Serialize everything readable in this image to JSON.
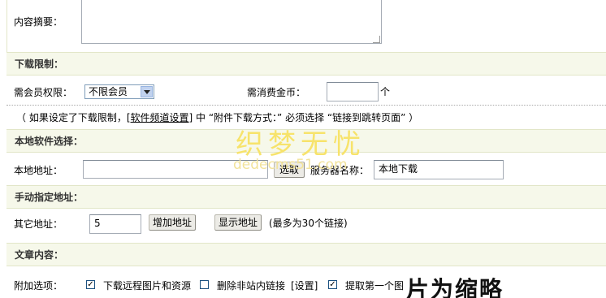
{
  "summary": {
    "label": "内容摘要：",
    "value": ""
  },
  "download_limit": {
    "section_title": "下载限制：",
    "member_label": "需会员权限：",
    "member_select": "不限会员",
    "coins_label": "需消费金币：",
    "coins_value": "",
    "coins_unit": "个",
    "note_prefix": "（ 如果设定了下载限制，[",
    "note_link": "软件频道设置",
    "note_suffix": "] 中 “附件下载方式：” 必须选择 “链接到跳转页面” ）"
  },
  "local_software": {
    "section_title": "本地软件选择：",
    "address_label": "本地地址：",
    "address_value": "",
    "select_button": "选取",
    "server_label": "服务器名称：",
    "server_value": "本地下载"
  },
  "manual_address": {
    "section_title": "手动指定地址：",
    "other_label": "其它地址：",
    "other_value": "5",
    "add_button": "增加地址",
    "show_button": "显示地址",
    "hint": "(最多为30个链接)"
  },
  "article_content": {
    "section_title": "文章内容：",
    "options_label": "附加选项：",
    "option_remote": "下载远程图片和资源",
    "option_remote_checked": true,
    "option_remove_links": "删除非站内链接",
    "option_remove_links_checked": false,
    "option_settings_link": "[设置]",
    "option_first_image": "提取第一个图",
    "option_first_image_checked": true,
    "overflow_text": "片为缩略"
  },
  "watermark": {
    "cn": "织梦无忧",
    "en": "dedecms51.com"
  }
}
